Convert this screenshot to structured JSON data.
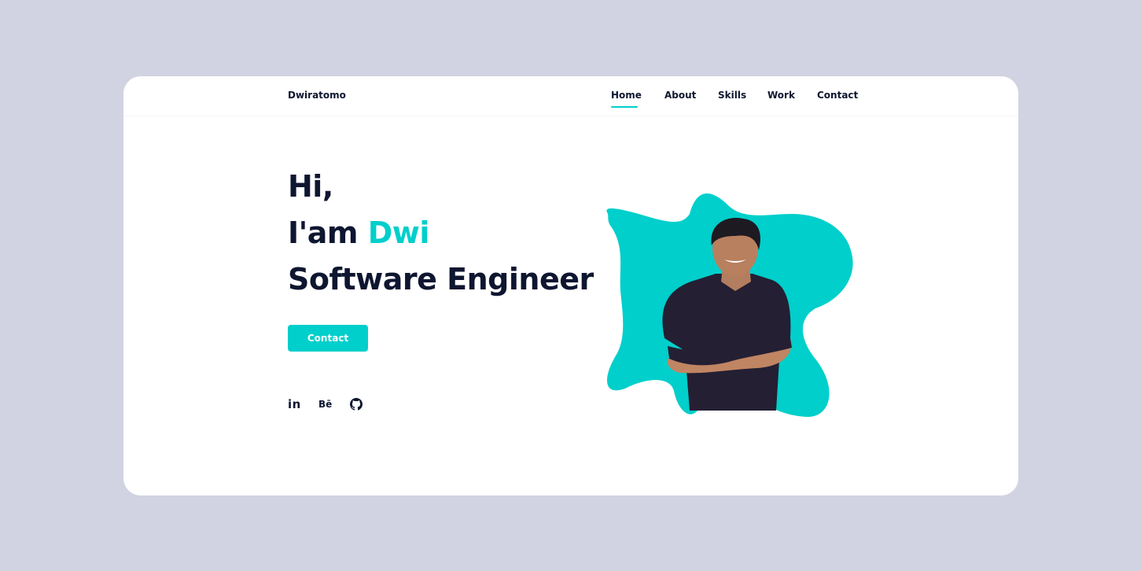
{
  "header": {
    "logo": "Dwiratomo",
    "nav": [
      {
        "label": "Home",
        "active": true
      },
      {
        "label": "About"
      },
      {
        "label": "Skills"
      },
      {
        "label": "Work"
      },
      {
        "label": "Contact"
      }
    ]
  },
  "hero": {
    "greeting": "Hi,",
    "intro": "I'am ",
    "name": "Dwi",
    "role": "Software Engineer",
    "button": "Contact"
  },
  "social": {
    "linkedin": "in",
    "behance": "Bē",
    "github_icon": "github-icon"
  },
  "colors": {
    "accent": "#00cfcb",
    "text": "#0e1630",
    "background": "#d1d3e2",
    "card": "#ffffff"
  }
}
